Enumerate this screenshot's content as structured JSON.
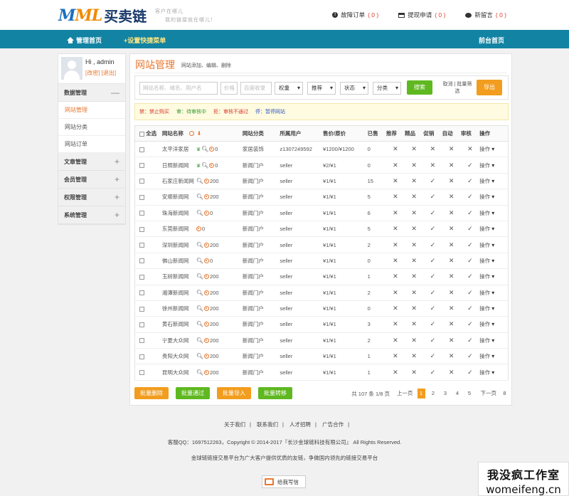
{
  "header": {
    "logo_mark_1": "M",
    "logo_mark_2": "ML",
    "logo_cn": "买卖链",
    "slogan_1": "客户在哪儿",
    "slogan_2": "我的链接就在哪儿!",
    "links": [
      {
        "label": "故障订单",
        "count": "( 0 )",
        "icon": "alert-icon"
      },
      {
        "label": "提现申请",
        "count": "( 0 )",
        "icon": "card-icon"
      },
      {
        "label": "新留言",
        "count": "( 0 )",
        "icon": "chat-icon"
      }
    ]
  },
  "nav": {
    "home": "管理首页",
    "quick": "+设置快捷菜单",
    "front": "前台首页"
  },
  "sidebar": {
    "greeting": "Hi , admin",
    "links": "[改密] [退出]",
    "groups": [
      {
        "label": "数据管理",
        "sign": "—",
        "items": [
          "网站管理",
          "网站分类",
          "网站订单"
        ]
      },
      {
        "label": "文章管理",
        "sign": "+"
      },
      {
        "label": "会员管理",
        "sign": "+"
      },
      {
        "label": "权限管理",
        "sign": "+"
      },
      {
        "label": "系统管理",
        "sign": "+"
      }
    ]
  },
  "main": {
    "title": "网站管理",
    "subtitle": "网站添加、编辑、删除",
    "filters": {
      "name_placeholder": "网站名称、域名、用户名",
      "price_placeholder": "价格",
      "baidu_placeholder": "百度收录",
      "weight": "权重",
      "recommend": "推荐",
      "status": "状态",
      "category": "分类",
      "search": "搜索",
      "cancel": "取消 | 批量筛选",
      "export": "导出"
    },
    "legend": {
      "red": "禁：禁止购买",
      "green": "审：待审核中",
      "red2": "拒：审核不通过",
      "blue": "停：暂停网站"
    },
    "columns": [
      "全选",
      "网站名称",
      "网站分类",
      "所属用户",
      "售价/原价",
      "已售",
      "推荐",
      "精品",
      "促销",
      "自动",
      "审核",
      "操作"
    ],
    "rows": [
      {
        "name": "太平洋家居",
        "crown": true,
        "search": true,
        "num": "0",
        "cat": "家居装饰",
        "user": "z1307249592",
        "price": "¥1200/¥1200",
        "sold": "0",
        "flags": [
          "x",
          "x",
          "x",
          "x",
          "x"
        ],
        "op": "操作"
      },
      {
        "name": "日照新闻网",
        "crown": true,
        "search": true,
        "num": "0",
        "cat": "新闻门户",
        "user": "seller",
        "price": "¥2/¥1",
        "sold": "0",
        "flags": [
          "x",
          "x",
          "x",
          "x",
          "ok"
        ],
        "op": "操作"
      },
      {
        "name": "石家庄新闻网",
        "crown": false,
        "search": true,
        "num": "200",
        "cat": "新闻门户",
        "user": "seller",
        "price": "¥1/¥1",
        "sold": "15",
        "flags": [
          "x",
          "x",
          "ok",
          "x",
          "ok"
        ],
        "op": "操作"
      },
      {
        "name": "安顺新闻网",
        "crown": false,
        "search": true,
        "num": "200",
        "cat": "新闻门户",
        "user": "seller",
        "price": "¥1/¥1",
        "sold": "5",
        "flags": [
          "x",
          "x",
          "ok",
          "x",
          "ok"
        ],
        "op": "操作"
      },
      {
        "name": "珠海新闻网",
        "crown": false,
        "search": true,
        "num": "0",
        "cat": "新闻门户",
        "user": "seller",
        "price": "¥1/¥1",
        "sold": "6",
        "flags": [
          "x",
          "x",
          "ok",
          "x",
          "ok"
        ],
        "op": "操作"
      },
      {
        "name": "东莞新闻网",
        "crown": false,
        "search": false,
        "num": "0",
        "cat": "新闻门户",
        "user": "seller",
        "price": "¥1/¥1",
        "sold": "5",
        "flags": [
          "x",
          "x",
          "ok",
          "x",
          "ok"
        ],
        "op": "操作"
      },
      {
        "name": "深圳新闻网",
        "crown": false,
        "search": true,
        "num": "200",
        "cat": "新闻门户",
        "user": "seller",
        "price": "¥1/¥1",
        "sold": "2",
        "flags": [
          "x",
          "x",
          "ok",
          "x",
          "ok"
        ],
        "op": "操作"
      },
      {
        "name": "佛山新闻网",
        "crown": false,
        "search": true,
        "num": "0",
        "cat": "新闻门户",
        "user": "seller",
        "price": "¥1/¥1",
        "sold": "0",
        "flags": [
          "x",
          "x",
          "ok",
          "x",
          "ok"
        ],
        "op": "操作"
      },
      {
        "name": "玉树新闻网",
        "crown": false,
        "search": true,
        "num": "200",
        "cat": "新闻门户",
        "user": "seller",
        "price": "¥1/¥1",
        "sold": "1",
        "flags": [
          "x",
          "x",
          "ok",
          "x",
          "ok"
        ],
        "op": "操作"
      },
      {
        "name": "湘潭新闻网",
        "crown": false,
        "search": true,
        "num": "200",
        "cat": "新闻门户",
        "user": "seller",
        "price": "¥1/¥1",
        "sold": "2",
        "flags": [
          "x",
          "x",
          "ok",
          "x",
          "ok"
        ],
        "op": "操作"
      },
      {
        "name": "徐州新闻网",
        "crown": false,
        "search": true,
        "num": "200",
        "cat": "新闻门户",
        "user": "seller",
        "price": "¥1/¥1",
        "sold": "0",
        "flags": [
          "x",
          "x",
          "ok",
          "x",
          "ok"
        ],
        "op": "操作"
      },
      {
        "name": "黄石新闻网",
        "crown": false,
        "search": true,
        "num": "200",
        "cat": "新闻门户",
        "user": "seller",
        "price": "¥1/¥1",
        "sold": "3",
        "flags": [
          "x",
          "x",
          "ok",
          "x",
          "ok"
        ],
        "op": "操作"
      },
      {
        "name": "宁夏大众网",
        "crown": false,
        "search": true,
        "num": "200",
        "cat": "新闻门户",
        "user": "seller",
        "price": "¥1/¥1",
        "sold": "2",
        "flags": [
          "x",
          "x",
          "ok",
          "x",
          "ok"
        ],
        "op": "操作"
      },
      {
        "name": "贵阳大众网",
        "crown": false,
        "search": true,
        "num": "200",
        "cat": "新闻门户",
        "user": "seller",
        "price": "¥1/¥1",
        "sold": "1",
        "flags": [
          "x",
          "x",
          "ok",
          "x",
          "ok"
        ],
        "op": "操作"
      },
      {
        "name": "昆明大众网",
        "crown": false,
        "search": true,
        "num": "200",
        "cat": "新闻门户",
        "user": "seller",
        "price": "¥1/¥1",
        "sold": "1",
        "flags": [
          "x",
          "x",
          "ok",
          "x",
          "ok"
        ],
        "op": "操作"
      }
    ],
    "actions": [
      "批量删除",
      "批量通过",
      "批量导入",
      "批量转移"
    ],
    "pager": {
      "summary": "共 107 条 1/8 页",
      "prev": "上一页",
      "pages": [
        "1",
        "2",
        "3",
        "4",
        "5"
      ],
      "next": "下一页",
      "last": "8"
    }
  },
  "footer": {
    "links": [
      "关于我们",
      "联系我们",
      "人才招聘",
      "广告合作"
    ],
    "copyright": "客服QQ：1697512263，Copyright © 2014-2017『长沙金球链科技有限公司』 All Rights Reserved.",
    "slogan": "金球链链接交易平台为广大客户提供优质的友链，争做国内领先的链接交易平台",
    "mail": "给我写信"
  },
  "watermark": {
    "line1": "我没疯工作室",
    "line2": "womeifeng.cn"
  },
  "colors": {
    "accent": "#e8772e",
    "nav": "#1383a3",
    "green": "#5fb820",
    "orange": "#f29d1e",
    "red": "#d9362b"
  }
}
